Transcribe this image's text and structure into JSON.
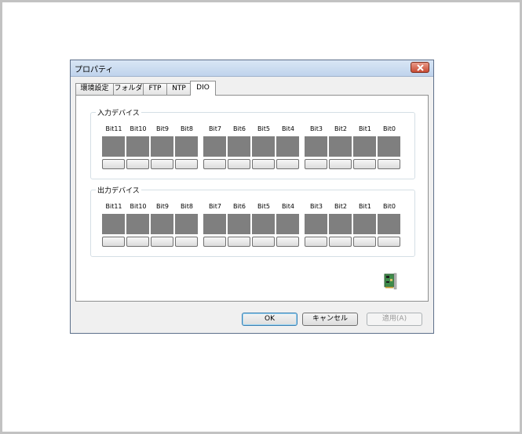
{
  "window": {
    "title": "プロパティ"
  },
  "tabs": [
    {
      "label": "環境設定"
    },
    {
      "label": "フォルダ"
    },
    {
      "label": "FTP"
    },
    {
      "label": "NTP"
    },
    {
      "label": "DIO"
    }
  ],
  "active_tab": "DIO",
  "input_group": {
    "label": "入力デバイス",
    "bits": [
      "Bit11",
      "Bit10",
      "Bit9",
      "Bit8",
      "Bit7",
      "Bit6",
      "Bit5",
      "Bit4",
      "Bit3",
      "Bit2",
      "Bit1",
      "Bit0"
    ]
  },
  "output_group": {
    "label": "出力デバイス",
    "bits": [
      "Bit11",
      "Bit10",
      "Bit9",
      "Bit8",
      "Bit7",
      "Bit6",
      "Bit5",
      "Bit4",
      "Bit3",
      "Bit2",
      "Bit1",
      "Bit0"
    ]
  },
  "buttons": {
    "ok": "OK",
    "cancel": "キャンセル",
    "apply": "適用(A)"
  },
  "icons": {
    "close": "close-icon",
    "card": "io-card-icon"
  },
  "colors": {
    "led_off": "#7f7f7f",
    "close": "#c74a33"
  }
}
